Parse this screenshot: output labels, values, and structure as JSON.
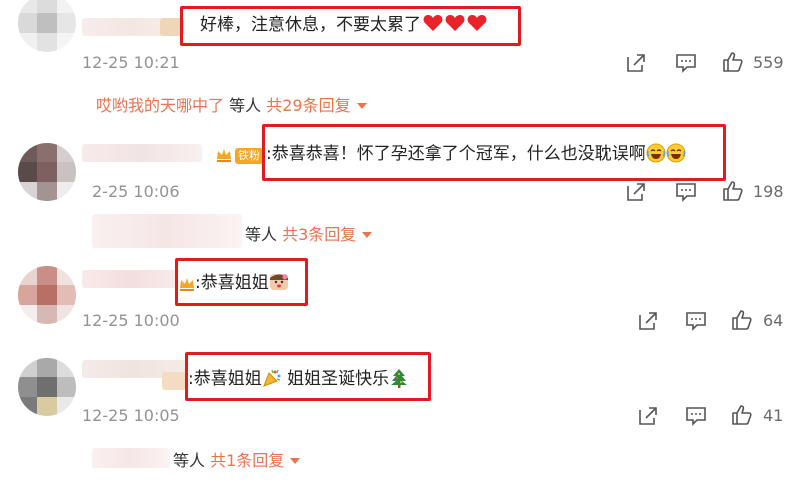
{
  "comments": [
    {
      "text": "好棒，注意休息，不要太累了",
      "hearts": 3,
      "time": "12-25 10:21",
      "likes": "559",
      "reply": {
        "user": "哎哟我的天哪中了",
        "middle": " 等人 ",
        "total": "共29条回复"
      }
    },
    {
      "badge": "铁粉",
      "text": ":恭喜恭喜！怀了孕还拿了个冠军，什么也没耽误啊",
      "time": "2-25 10:06",
      "likes": "198",
      "reply": {
        "middle": "等人 ",
        "total": "共3条回复"
      }
    },
    {
      "text": ":恭喜姐姐",
      "time": "12-25 10:00",
      "likes": "64"
    },
    {
      "text": ":恭喜姐姐",
      "text2": " 姐姐圣诞快乐",
      "time": "12-25 10:05",
      "likes": "41",
      "reply": {
        "middle": "等人 ",
        "total": "共1条回复"
      }
    }
  ],
  "icons": {
    "share": "share-icon",
    "comment": "comment-icon",
    "like": "like-icon"
  },
  "colors": {
    "highlight": "#e01d1d",
    "accent": "#eb7350",
    "time": "#939393"
  }
}
